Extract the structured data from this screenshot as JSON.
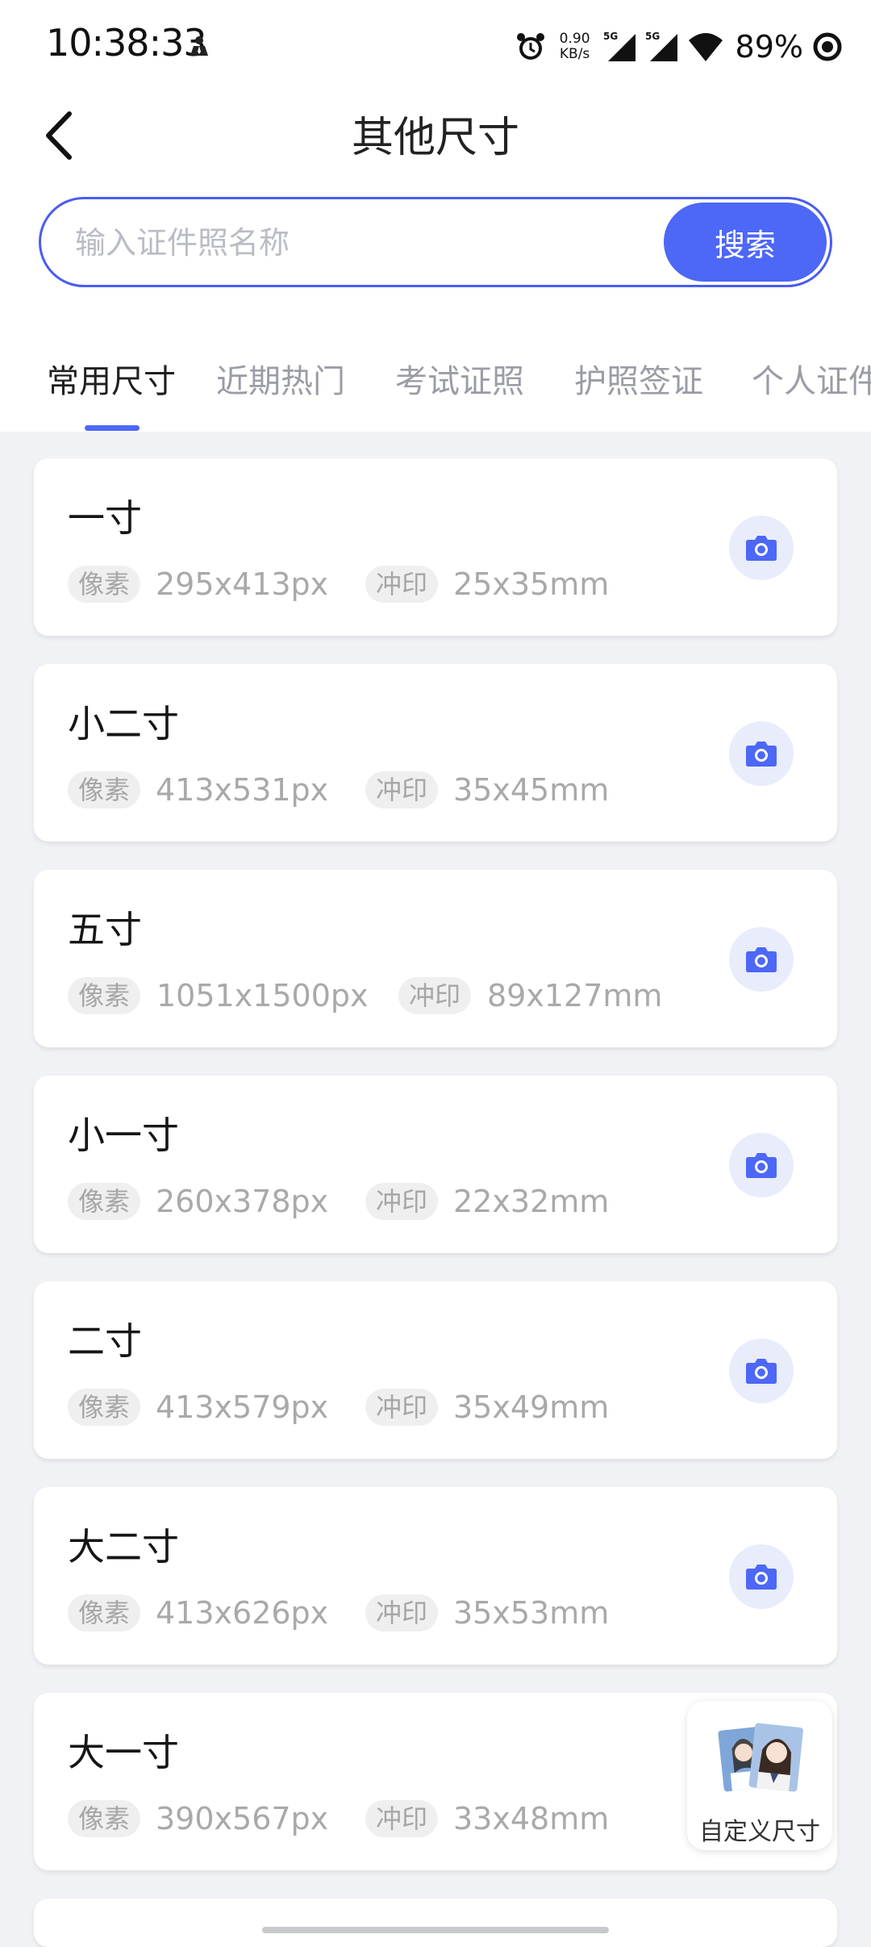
{
  "status_bar": {
    "time": "10:38:33",
    "net_speed_value": "0.90",
    "net_speed_unit": "KB/s",
    "signal_1": "5G",
    "signal_2": "5G",
    "battery": "89%"
  },
  "header": {
    "title": "其他尺寸"
  },
  "search": {
    "placeholder": "输入证件照名称",
    "button_label": "搜索"
  },
  "tabs": [
    {
      "label": "常用尺寸",
      "active": true
    },
    {
      "label": "近期热门",
      "active": false
    },
    {
      "label": "考试证照",
      "active": false
    },
    {
      "label": "护照签证",
      "active": false
    },
    {
      "label": "个人证件",
      "active": false
    }
  ],
  "labels": {
    "pixel": "像素",
    "print": "冲印"
  },
  "sizes": [
    {
      "name": "一寸",
      "pixels": "295x413px",
      "print": "25x35mm"
    },
    {
      "name": "小二寸",
      "pixels": "413x531px",
      "print": "35x45mm"
    },
    {
      "name": "五寸",
      "pixels": "1051x1500px",
      "print": "89x127mm"
    },
    {
      "name": "小一寸",
      "pixels": "260x378px",
      "print": "22x32mm"
    },
    {
      "name": "二寸",
      "pixels": "413x579px",
      "print": "35x49mm"
    },
    {
      "name": "大二寸",
      "pixels": "413x626px",
      "print": "35x53mm"
    },
    {
      "name": "大一寸",
      "pixels": "390x567px",
      "print": "33x48mm"
    }
  ],
  "custom_size": {
    "label": "自定义尺寸"
  },
  "colors": {
    "accent": "#4d67f7",
    "camera_bg": "#e8ecfb",
    "page_bg": "#f1f2f5"
  }
}
